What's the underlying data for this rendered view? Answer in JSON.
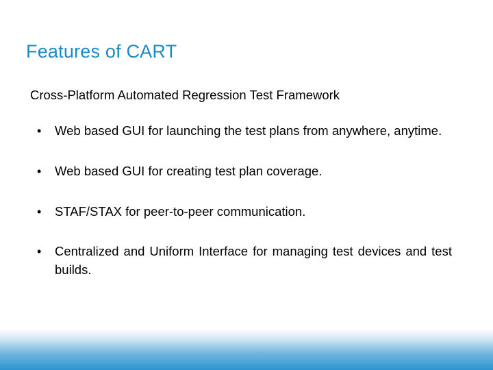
{
  "title": "Features of CART",
  "subtitle": "Cross-Platform Automated Regression Test Framework",
  "bullets": [
    "Web based GUI for launching the test plans from anywhere, anytime.",
    "Web based GUI for creating test plan coverage.",
    "STAF/STAX for peer-to-peer communication.",
    "Centralized and Uniform Interface for managing test devices and test builds."
  ]
}
